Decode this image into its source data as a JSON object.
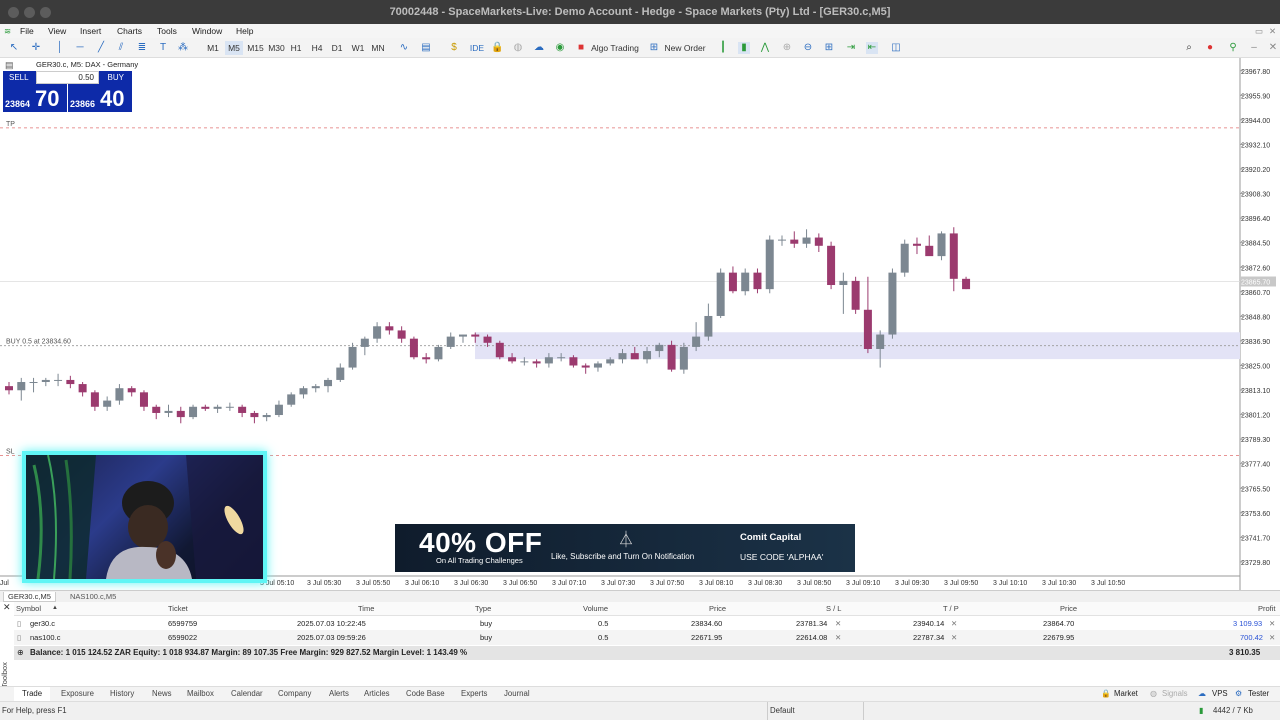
{
  "window": {
    "title": "70002448 - SpaceMarkets-Live: Demo Account - Hedge - Space Markets (Pty) Ltd - [GER30.c,M5]"
  },
  "menu": [
    "File",
    "View",
    "Insert",
    "Charts",
    "Tools",
    "Window",
    "Help"
  ],
  "toolbar": {
    "timeframes": [
      "M1",
      "M5",
      "M15",
      "M30",
      "H1",
      "H4",
      "D1",
      "W1",
      "MN"
    ],
    "active_timeframe": "M5",
    "ide_label": "IDE",
    "algo_trading_label": "Algo Trading",
    "new_order_label": "New Order"
  },
  "chart": {
    "symbol_label": "GER30.c, M5:  DAX - Germany",
    "one_click": {
      "sell_label": "SELL",
      "buy_label": "BUY",
      "volume": "0.50",
      "sell_small": "23864",
      "sell_big": "70",
      "buy_small": "23866",
      "buy_big": "40"
    },
    "tp_label": "TP",
    "sl_label": "SL",
    "order_label": "BUY 0.5 at 23834.60",
    "current_price_label": "23865.70"
  },
  "chart_data": {
    "type": "candlestick",
    "y_ticks": [
      "23967.80",
      "23955.90",
      "23944.00",
      "23932.10",
      "23920.20",
      "23908.30",
      "23896.40",
      "23884.50",
      "23872.60",
      "23860.70",
      "23848.80",
      "23836.90",
      "23825.00",
      "23813.10",
      "23801.20",
      "23789.30",
      "23777.40",
      "23765.50",
      "23753.60",
      "23741.70",
      "23729.80"
    ],
    "x_ticks": [
      "3 Jul",
      "3 Jul 05:10",
      "3 Jul 05:30",
      "3 Jul 05:50",
      "3 Jul 06:10",
      "3 Jul 06:30",
      "3 Jul 06:50",
      "3 Jul 07:10",
      "3 Jul 07:30",
      "3 Jul 07:50",
      "3 Jul 08:10",
      "3 Jul 08:30",
      "3 Jul 08:50",
      "3 Jul 09:10",
      "3 Jul 09:30",
      "3 Jul 09:50",
      "3 Jul 10:10",
      "3 Jul 10:30",
      "3 Jul 10:50"
    ],
    "ylim": [
      23723.0,
      23974.0
    ],
    "candles": [
      [
        23815,
        23817,
        23811,
        23813
      ],
      [
        23813,
        23819,
        23808,
        23817
      ],
      [
        23817,
        23819,
        23812,
        23817
      ],
      [
        23817,
        23819,
        23815,
        23818
      ],
      [
        23818,
        23821,
        23815,
        23818
      ],
      [
        23818,
        23820,
        23814,
        23816
      ],
      [
        23816,
        23817,
        23810,
        23812
      ],
      [
        23812,
        23813,
        23803,
        23805
      ],
      [
        23805,
        23810,
        23803,
        23808
      ],
      [
        23808,
        23816,
        23806,
        23814
      ],
      [
        23814,
        23815,
        23810,
        23812
      ],
      [
        23812,
        23813,
        23803,
        23805
      ],
      [
        23805,
        23806,
        23799,
        23802
      ],
      [
        23802,
        23806,
        23800,
        23803
      ],
      [
        23803,
        23805,
        23797,
        23800
      ],
      [
        23800,
        23806,
        23799,
        23805
      ],
      [
        23805,
        23806,
        23803,
        23804
      ],
      [
        23804,
        23806,
        23802,
        23805
      ],
      [
        23805,
        23807,
        23803,
        23805
      ],
      [
        23805,
        23806,
        23800,
        23802
      ],
      [
        23802,
        23803,
        23797,
        23800
      ],
      [
        23800,
        23802,
        23798,
        23801
      ],
      [
        23801,
        23808,
        23800,
        23806
      ],
      [
        23806,
        23812,
        23805,
        23811
      ],
      [
        23811,
        23815,
        23809,
        23814
      ],
      [
        23814,
        23816,
        23812,
        23815
      ],
      [
        23815,
        23819,
        23812,
        23818
      ],
      [
        23818,
        23826,
        23817,
        23824
      ],
      [
        23824,
        23836,
        23823,
        23834
      ],
      [
        23834,
        23839,
        23830,
        23838
      ],
      [
        23838,
        23846,
        23836,
        23844
      ],
      [
        23844,
        23846,
        23840,
        23842
      ],
      [
        23842,
        23844,
        23836,
        23838
      ],
      [
        23838,
        23839,
        23828,
        23829
      ],
      [
        23829,
        23831,
        23826,
        23828
      ],
      [
        23828,
        23835,
        23827,
        23834
      ],
      [
        23834,
        23841,
        23833,
        23839
      ],
      [
        23839,
        23840,
        23836,
        23840
      ],
      [
        23840,
        23841,
        23836,
        23839
      ],
      [
        23839,
        23840,
        23834,
        23836
      ],
      [
        23836,
        23837,
        23828,
        23829
      ],
      [
        23829,
        23831,
        23826,
        23827
      ],
      [
        23827,
        23829,
        23825,
        23827
      ],
      [
        23827,
        23828,
        23824,
        23826
      ],
      [
        23826,
        23831,
        23824,
        23829
      ],
      [
        23829,
        23831,
        23827,
        23829
      ],
      [
        23829,
        23830,
        23824,
        23825
      ],
      [
        23825,
        23826,
        23821,
        23824
      ],
      [
        23824,
        23827,
        23822,
        23826
      ],
      [
        23826,
        23829,
        23825,
        23828
      ],
      [
        23828,
        23833,
        23826,
        23831
      ],
      [
        23831,
        23834,
        23829,
        23828
      ],
      [
        23828,
        23834,
        23826,
        23832
      ],
      [
        23832,
        23836,
        23829,
        23835
      ],
      [
        23835,
        23837,
        23822,
        23823
      ],
      [
        23823,
        23836,
        23821,
        23834
      ],
      [
        23834,
        23846,
        23832,
        23839
      ],
      [
        23839,
        23855,
        23837,
        23849
      ],
      [
        23849,
        23872,
        23848,
        23870
      ],
      [
        23870,
        23873,
        23860,
        23861
      ],
      [
        23861,
        23872,
        23859,
        23870
      ],
      [
        23870,
        23872,
        23860,
        23862
      ],
      [
        23862,
        23888,
        23860,
        23886
      ],
      [
        23886,
        23888,
        23883,
        23886
      ],
      [
        23886,
        23890,
        23882,
        23884
      ],
      [
        23884,
        23891,
        23882,
        23887
      ],
      [
        23887,
        23889,
        23880,
        23883
      ],
      [
        23883,
        23885,
        23862,
        23864
      ],
      [
        23864,
        23870,
        23850,
        23866
      ],
      [
        23866,
        23868,
        23850,
        23852
      ],
      [
        23852,
        23868,
        23831,
        23833
      ],
      [
        23833,
        23842,
        23824,
        23840
      ],
      [
        23840,
        23872,
        23838,
        23870
      ],
      [
        23870,
        23886,
        23868,
        23884
      ],
      [
        23884,
        23887,
        23879,
        23883
      ],
      [
        23883,
        23888,
        23880,
        23878
      ],
      [
        23878,
        23890,
        23876,
        23889
      ],
      [
        23889,
        23892,
        23861,
        23867
      ],
      [
        23867,
        23868,
        23862,
        23862
      ]
    ],
    "trade_levels": {
      "tp": 23940.14,
      "entry": 23834.6,
      "sl": 23781.34,
      "current": 23865.7
    }
  },
  "banner": {
    "headline": "40% OFF",
    "sub": "On All Trading Challenges",
    "middle": "Like, Subscribe and Turn On Notification",
    "brand": "Comit Capital",
    "code": "USE CODE 'ALPHAA'"
  },
  "chart_tabs": [
    "GER30.c,M5",
    "NAS100.c,M5"
  ],
  "trade_table": {
    "headers": [
      "Symbol",
      "Ticket",
      "Time",
      "Type",
      "Volume",
      "Price",
      "S / L",
      "T / P",
      "Price",
      "Profit"
    ],
    "rows": [
      {
        "symbol": "ger30.c",
        "ticket": "6599759",
        "time": "2025.07.03 10:22:45",
        "type": "buy",
        "volume": "0.5",
        "price": "23834.60",
        "sl": "23781.34",
        "tp": "23940.14",
        "cur_price": "23864.70",
        "profit": "3 109.93"
      },
      {
        "symbol": "nas100.c",
        "ticket": "6599022",
        "time": "2025.07.03 09:59:26",
        "type": "buy",
        "volume": "0.5",
        "price": "22671.95",
        "sl": "22614.08",
        "tp": "22787.34",
        "cur_price": "22679.95",
        "profit": "700.42"
      }
    ],
    "balance_line": "Balance: 1 015 124.52 ZAR  Equity: 1 018 934.87  Margin: 89 107.35  Free Margin: 929 827.52  Margin Level: 1 143.49 %",
    "total_profit": "3 810.35"
  },
  "toolbox_label": "Toolbox",
  "bottom_tabs": [
    "Trade",
    "Exposure",
    "History",
    "News",
    "Mailbox",
    "Calendar",
    "Company",
    "Alerts",
    "Articles",
    "Code Base",
    "Experts",
    "Journal"
  ],
  "bottom_right": {
    "market": "Market",
    "signals": "Signals",
    "vps": "VPS",
    "tester": "Tester"
  },
  "status": {
    "help": "For Help, press F1",
    "profile": "Default",
    "traffic": "4442 / 7 Kb"
  },
  "colors": {
    "bull": "#7c8791",
    "bear": "#9b3a6e",
    "order_band": "#e3e3f6",
    "profit": "#2952d6"
  }
}
